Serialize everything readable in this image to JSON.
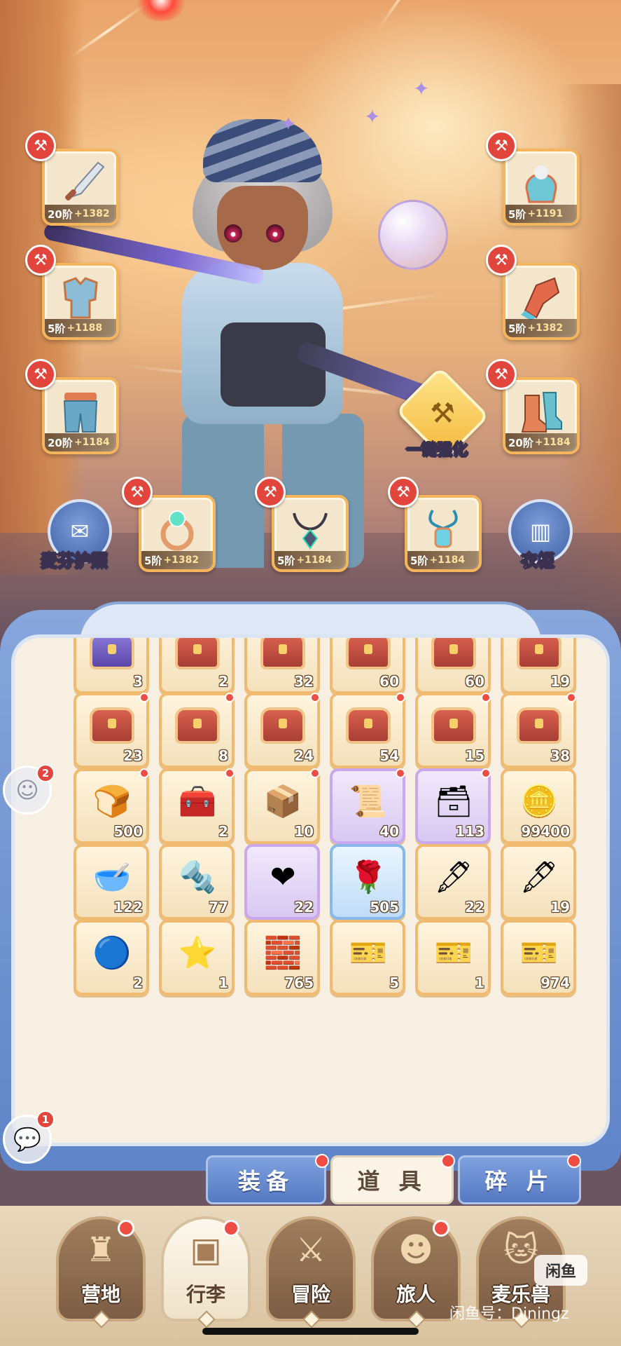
{
  "equipment": {
    "weapon": {
      "tier": "20阶",
      "bonus": "+1382"
    },
    "helmet": {
      "tier": "5阶",
      "bonus": "+1191"
    },
    "armor": {
      "tier": "5阶",
      "bonus": "+1188"
    },
    "gloves": {
      "tier": "5阶",
      "bonus": "+1382"
    },
    "pants": {
      "tier": "20阶",
      "bonus": "+1184"
    },
    "boots": {
      "tier": "20阶",
      "bonus": "+1184"
    },
    "ring": {
      "tier": "5阶",
      "bonus": "+1382"
    },
    "necklace": {
      "tier": "5阶",
      "bonus": "+1184"
    },
    "amulet": {
      "tier": "5阶",
      "bonus": "+1184"
    }
  },
  "buttons": {
    "passport": "麦芬护照",
    "wardrobe": "衣柜",
    "enhance": "一键强化"
  },
  "inventory": {
    "rows": [
      [
        {
          "count": "3",
          "type": "chest-purple"
        },
        {
          "count": "2",
          "type": "chest"
        },
        {
          "count": "32",
          "type": "chest"
        },
        {
          "count": "60",
          "type": "chest"
        },
        {
          "count": "60",
          "type": "chest"
        },
        {
          "count": "19",
          "type": "chest"
        }
      ],
      [
        {
          "count": "23",
          "type": "chest",
          "dot": true
        },
        {
          "count": "8",
          "type": "chest",
          "dot": true
        },
        {
          "count": "24",
          "type": "chest",
          "dot": true
        },
        {
          "count": "54",
          "type": "chest",
          "dot": true
        },
        {
          "count": "15",
          "type": "chest",
          "dot": true
        },
        {
          "count": "38",
          "type": "chest",
          "dot": true
        }
      ],
      [
        {
          "count": "500",
          "type": "oven",
          "dot": true
        },
        {
          "count": "2",
          "type": "treasure",
          "dot": true
        },
        {
          "count": "10",
          "type": "purple-box",
          "dot": true
        },
        {
          "count": "40",
          "type": "scroll",
          "dot": true,
          "rarity": "purple"
        },
        {
          "count": "113",
          "type": "silver-chest",
          "dot": true,
          "rarity": "purple"
        },
        {
          "count": "99400",
          "type": "gold-bars"
        }
      ],
      [
        {
          "count": "122",
          "type": "bowl"
        },
        {
          "count": "77",
          "type": "coins"
        },
        {
          "count": "22",
          "type": "heart-bear",
          "rarity": "purple"
        },
        {
          "count": "505",
          "type": "rose",
          "rarity": "blue"
        },
        {
          "count": "22",
          "type": "ink-yellow"
        },
        {
          "count": "19",
          "type": "ink-purple"
        }
      ],
      [
        {
          "count": "2",
          "type": "mirror"
        },
        {
          "count": "1",
          "type": "star-card"
        },
        {
          "count": "765",
          "type": "iron"
        },
        {
          "count": "5",
          "type": "ticket-blue"
        },
        {
          "count": "1",
          "type": "ticket-black"
        },
        {
          "count": "974",
          "type": "ticket-teal"
        }
      ]
    ]
  },
  "side": {
    "npc_badge": "2",
    "chat_badge": "1"
  },
  "tabs": [
    {
      "label": "装备"
    },
    {
      "label": "道 具"
    },
    {
      "label": "碎 片"
    }
  ],
  "nav": [
    {
      "label": "营地"
    },
    {
      "label": "行李"
    },
    {
      "label": "冒险"
    },
    {
      "label": "旅人"
    },
    {
      "label": "麦乐兽"
    }
  ],
  "watermark": {
    "logo": "闲鱼",
    "text": "闲鱼号：Diningz"
  },
  "colors": {
    "accent_red": "#e2453c",
    "panel_blue": "#6f93d2",
    "slot_orange": "#f5b55c"
  }
}
